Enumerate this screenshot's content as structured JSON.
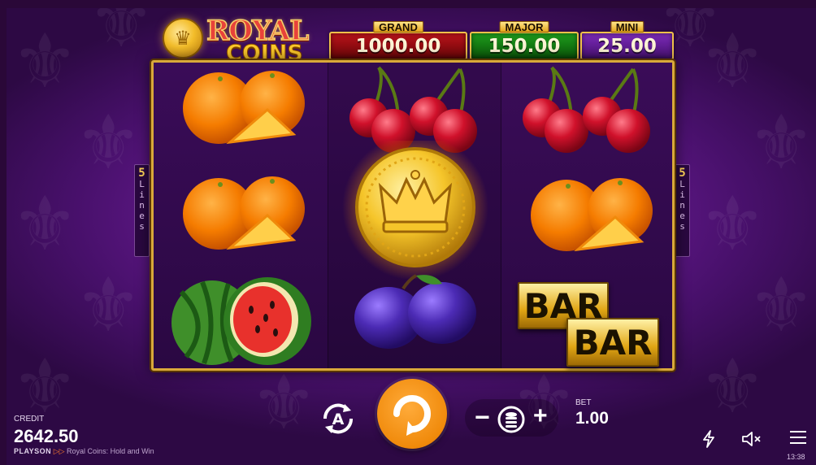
{
  "game": {
    "logo_line1": "ROYAL",
    "logo_line2": "COINS"
  },
  "jackpots": [
    {
      "label": "GRAND",
      "value": "1000.00",
      "color": "#b8131a"
    },
    {
      "label": "MAJOR",
      "value": "150.00",
      "color": "#1e9b1c"
    },
    {
      "label": "MINI",
      "value": "25.00",
      "color": "#7b2bb7"
    }
  ],
  "reels": [
    [
      "orange",
      "orange",
      "watermelon"
    ],
    [
      "cherry",
      "crown-coin",
      "plum"
    ],
    [
      "cherry",
      "orange",
      "bar"
    ]
  ],
  "bar_symbol": {
    "top": "BAR",
    "bottom": "BAR"
  },
  "lines_indicator": {
    "count": "5",
    "word": "Lines"
  },
  "credit": {
    "label": "CREDIT",
    "value": "2642.50"
  },
  "bet": {
    "label": "BET",
    "value": "1.00",
    "minus": "−",
    "plus": "+"
  },
  "footer": {
    "brand": "PLAYSON",
    "game_name": "Royal Coins: Hold and Win"
  },
  "clock": "13:38",
  "colors": {
    "spin": "#f08a0b",
    "frame_gold": "#d9a93a",
    "background": "#6a1b95"
  }
}
